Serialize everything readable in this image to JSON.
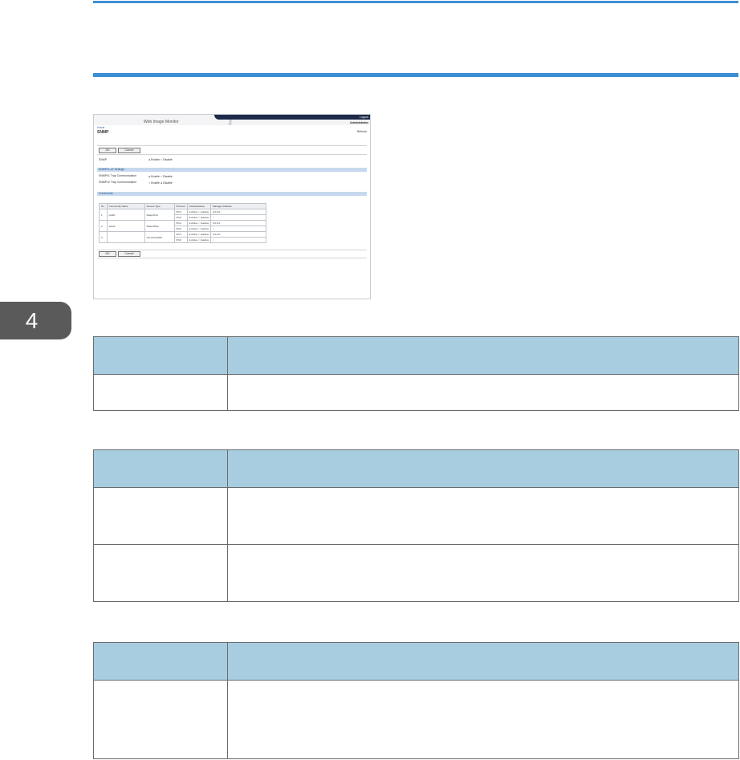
{
  "chapter": {
    "number": "4"
  },
  "screenshot": {
    "app_title": "Web Image Monitor",
    "logout": "Logout",
    "admin": "Administrator",
    "home": "Home",
    "page_title": "SNMP",
    "refresh": "Refresh",
    "ok": "OK",
    "cancel": "Cancel",
    "snmp_label": "SNMP",
    "enable": "Enable",
    "disable": "Disable",
    "section_v1v2": "SNMPv1,v2 Settings",
    "v1_trap": "SNMPv1 Trap Communication",
    "v2_trap": "SNMPv2 Trap Communication",
    "section_community": "Community",
    "table_headers": [
      "No.",
      "Community Name",
      "Access Type",
      "Protocol",
      "Active/Inactive",
      "Manager Address"
    ],
    "rows": [
      {
        "no": "1",
        "name": "public",
        "access": "Read-Only",
        "proto1": "IPv4",
        "proto2": "IPv6",
        "addr1": "0.0.0.0",
        "addr2": "::"
      },
      {
        "no": "2",
        "name": "admin",
        "access": "Read-Write",
        "proto1": "IPv4",
        "proto2": "IPv6",
        "addr1": "0.0.0.0",
        "addr2": "::"
      },
      {
        "no": "3",
        "name": "",
        "access": "Not Accessible",
        "proto1": "IPv4",
        "proto2": "IPv6",
        "addr1": "0.0.0.0",
        "addr2": "::"
      }
    ],
    "active": "Active",
    "inactive": "Inactive"
  }
}
